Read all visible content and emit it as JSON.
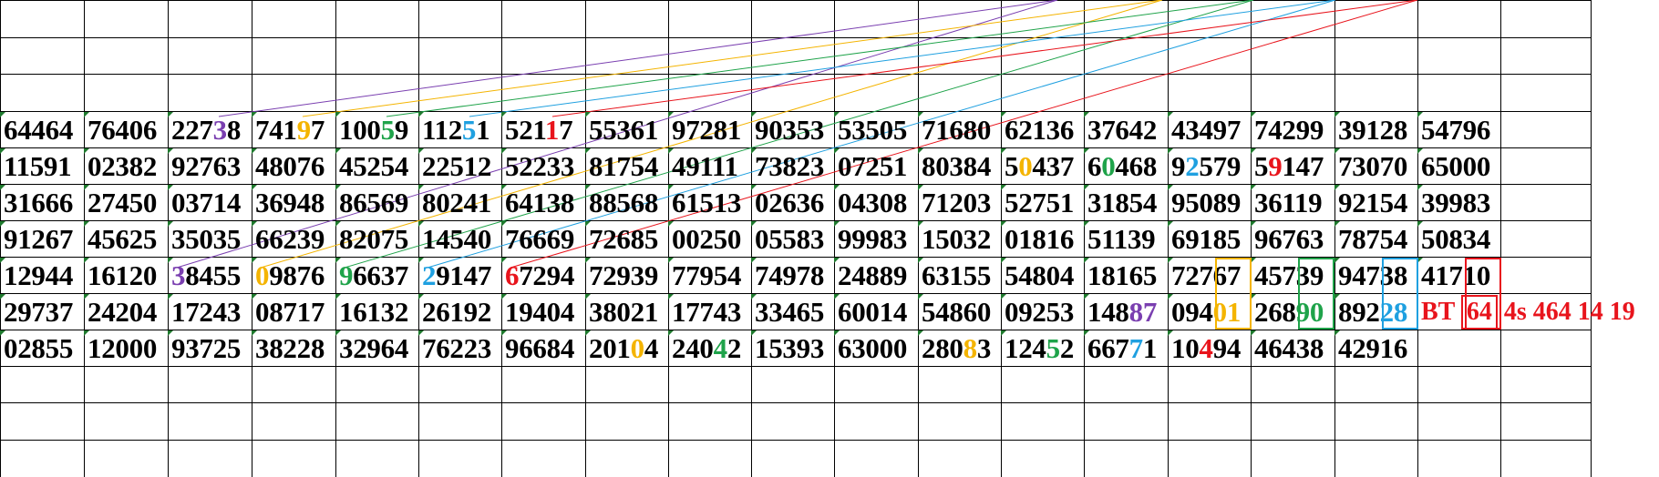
{
  "colors": {
    "purple": "#7a3fb0",
    "orange": "#f4b400",
    "green": "#1fa34a",
    "blue": "#1fa0e0",
    "red": "#e8141c",
    "grid": "#000000"
  },
  "rows": [
    [
      "64464",
      "76406",
      "22738",
      "74197",
      "10059",
      "11251",
      "52117",
      "55361",
      "97281",
      "90353",
      "53505",
      "71680",
      "62136",
      "37642",
      "43497",
      "74299",
      "39128",
      "54796"
    ],
    [
      "11591",
      "02382",
      "92763",
      "48076",
      "45254",
      "22512",
      "52233",
      "81754",
      "49111",
      "73823",
      "07251",
      "80384",
      "50437",
      "60468",
      "92579",
      "59147",
      "73070",
      "65000"
    ],
    [
      "31666",
      "27450",
      "03714",
      "36948",
      "86569",
      "80241",
      "64138",
      "88568",
      "61513",
      "02636",
      "04308",
      "71203",
      "52751",
      "31854",
      "95089",
      "36119",
      "92154",
      "39983"
    ],
    [
      "91267",
      "45625",
      "35035",
      "66239",
      "82075",
      "14540",
      "76669",
      "72685",
      "00250",
      "05583",
      "99983",
      "15032",
      "01816",
      "51139",
      "69185",
      "96763",
      "78754",
      "50834"
    ],
    [
      "12944",
      "16120",
      "38455",
      "09876",
      "96637",
      "29147",
      "67294",
      "72939",
      "77954",
      "74978",
      "24889",
      "63155",
      "54804",
      "18165",
      "72767",
      "45739",
      "94738",
      "41710"
    ],
    [
      "29737",
      "24204",
      "17243",
      "08717",
      "16132",
      "26192",
      "19404",
      "38021",
      "17743",
      "33465",
      "60014",
      "54860",
      "09253",
      "14887",
      "09401",
      "26890",
      "89228"
    ],
    [
      "02855",
      "12000",
      "93725",
      "38228",
      "32964",
      "76223",
      "96684",
      "20104",
      "24042",
      "15393",
      "63000",
      "28083",
      "12452",
      "66771",
      "10494",
      "46438",
      "42916"
    ]
  ],
  "highlights": [
    {
      "row": 0,
      "col": 2,
      "pos": 3,
      "color": "purple"
    },
    {
      "row": 0,
      "col": 3,
      "pos": 3,
      "color": "orange"
    },
    {
      "row": 0,
      "col": 4,
      "pos": 3,
      "color": "green"
    },
    {
      "row": 0,
      "col": 5,
      "pos": 3,
      "color": "blue"
    },
    {
      "row": 0,
      "col": 6,
      "pos": 3,
      "color": "red"
    },
    {
      "row": 1,
      "col": 12,
      "pos": 1,
      "color": "orange"
    },
    {
      "row": 1,
      "col": 13,
      "pos": 1,
      "color": "green"
    },
    {
      "row": 1,
      "col": 14,
      "pos": 1,
      "color": "blue"
    },
    {
      "row": 1,
      "col": 15,
      "pos": 1,
      "color": "red"
    },
    {
      "row": 4,
      "col": 2,
      "pos": 0,
      "color": "purple"
    },
    {
      "row": 4,
      "col": 3,
      "pos": 0,
      "color": "orange"
    },
    {
      "row": 4,
      "col": 4,
      "pos": 0,
      "color": "green"
    },
    {
      "row": 4,
      "col": 5,
      "pos": 0,
      "color": "blue"
    },
    {
      "row": 4,
      "col": 6,
      "pos": 0,
      "color": "red"
    },
    {
      "row": 5,
      "col": 13,
      "pos": 3,
      "color": "purple"
    },
    {
      "row": 5,
      "col": 13,
      "pos": 4,
      "color": "purple"
    },
    {
      "row": 5,
      "col": 14,
      "pos": 3,
      "color": "orange"
    },
    {
      "row": 5,
      "col": 14,
      "pos": 4,
      "color": "orange"
    },
    {
      "row": 5,
      "col": 15,
      "pos": 3,
      "color": "green"
    },
    {
      "row": 5,
      "col": 15,
      "pos": 4,
      "color": "green"
    },
    {
      "row": 5,
      "col": 16,
      "pos": 3,
      "color": "blue"
    },
    {
      "row": 5,
      "col": 16,
      "pos": 4,
      "color": "blue"
    },
    {
      "row": 6,
      "col": 7,
      "pos": 3,
      "color": "orange"
    },
    {
      "row": 6,
      "col": 8,
      "pos": 3,
      "color": "green"
    },
    {
      "row": 6,
      "col": 11,
      "pos": 3,
      "color": "orange"
    },
    {
      "row": 6,
      "col": 12,
      "pos": 3,
      "color": "green"
    },
    {
      "row": 6,
      "col": 13,
      "pos": 3,
      "color": "blue"
    },
    {
      "row": 6,
      "col": 14,
      "pos": 2,
      "color": "red"
    }
  ],
  "boxes": [
    {
      "row": 4,
      "col": 14,
      "color": "orange"
    },
    {
      "row": 4,
      "col": 15,
      "color": "green"
    },
    {
      "row": 4,
      "col": 16,
      "color": "blue"
    },
    {
      "row": 4,
      "col": 17,
      "color": "red"
    }
  ],
  "bt_note": {
    "prefix": "BT",
    "boxed": "64",
    "suffix": "4s 464 14 19"
  },
  "connector_lines": [
    {
      "color": "purple",
      "from_row": 0,
      "from_col": 2,
      "to_row": 4,
      "to_col": 2,
      "target": "top-1"
    },
    {
      "color": "orange",
      "from_row": 0,
      "from_col": 3,
      "to_row": 4,
      "to_col": 3,
      "target": "top-2"
    },
    {
      "color": "green",
      "from_row": 0,
      "from_col": 4,
      "to_row": 4,
      "to_col": 4,
      "target": "top-3"
    },
    {
      "color": "blue",
      "from_row": 0,
      "from_col": 5,
      "to_row": 4,
      "to_col": 5,
      "target": "top-4"
    },
    {
      "color": "red",
      "from_row": 0,
      "from_col": 6,
      "to_row": 4,
      "to_col": 6,
      "target": "top-5"
    }
  ]
}
